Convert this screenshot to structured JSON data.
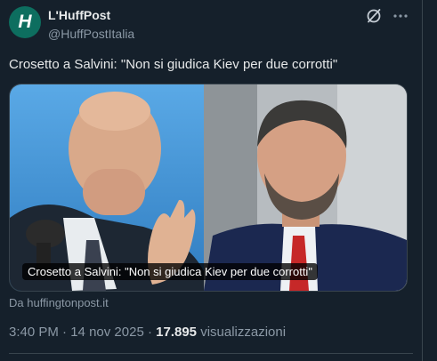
{
  "author": {
    "avatar_letter": "H",
    "name": "L'HuffPost",
    "handle": "@HuffPostItalia"
  },
  "tweet": {
    "text": "Crosetto a Salvini: \"Non si giudica Kiev per due corrotti\"",
    "media_caption": "Crosetto a Salvini: \"Non si giudica Kiev per due corrotti\"",
    "source": "Da huffingtonpost.it"
  },
  "meta": {
    "time": "3:40 PM",
    "separator": "·",
    "date": "14 nov 2025",
    "views_count": "17.895",
    "views_label": "visualizzazioni"
  },
  "icons": {
    "grok": "grok-icon",
    "more": "more-icon"
  },
  "colors": {
    "background": "#15202b",
    "text_primary": "#e7e9ea",
    "text_secondary": "#8b98a5",
    "border": "#38444d",
    "avatar_bg": "#0d6e5f"
  }
}
